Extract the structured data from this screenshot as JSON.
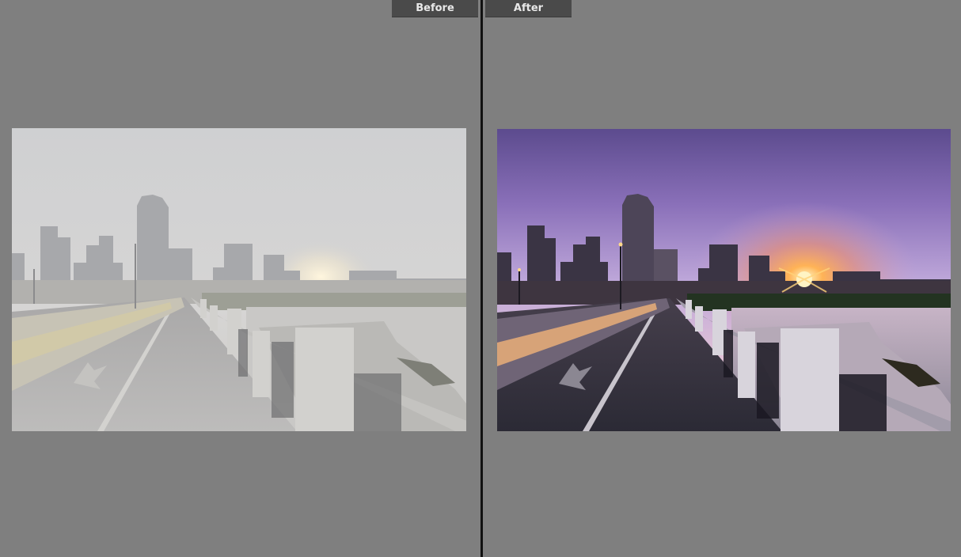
{
  "compare_view": {
    "before_label": "Before",
    "after_label": "After"
  },
  "colors": {
    "workspace_bg": "#7f7f7f",
    "label_bg": "#4a4a4a",
    "divider": "#111111"
  }
}
